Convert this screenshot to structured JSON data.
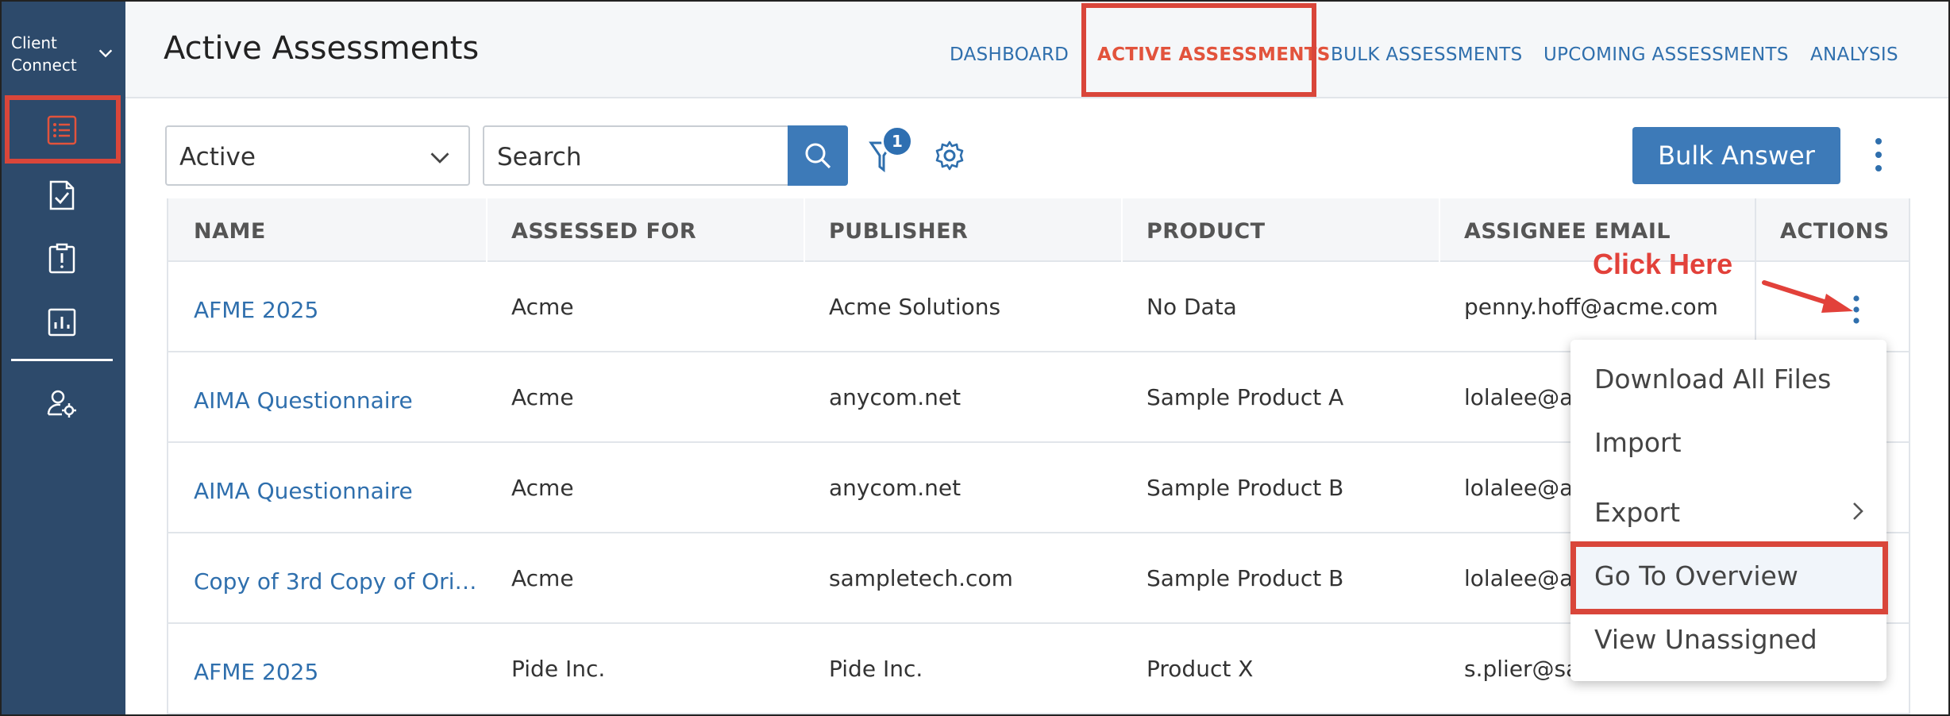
{
  "sidebar": {
    "client_label_line1": "Client",
    "client_label_line2": "Connect",
    "icons": [
      "list-icon",
      "checklist-icon",
      "alert-clipboard-icon",
      "report-chart-icon",
      "user-settings-icon"
    ]
  },
  "header": {
    "title": "Active Assessments",
    "nav": [
      "DASHBOARD",
      "ACTIVE ASSESSMENTS",
      "BULK ASSESSMENTS",
      "UPCOMING ASSESSMENTS",
      "ANALYSIS"
    ],
    "active_nav": "ACTIVE ASSESSMENTS"
  },
  "toolbar": {
    "status_select": "Active",
    "search_placeholder": "Search",
    "filter_count": "1",
    "bulk_answer_label": "Bulk Answer"
  },
  "table": {
    "columns": [
      "NAME",
      "ASSESSED FOR",
      "PUBLISHER",
      "PRODUCT",
      "ASSIGNEE EMAIL",
      "ACTIONS"
    ],
    "rows": [
      {
        "name": "AFME 2025",
        "assessed_for": "Acme",
        "publisher": "Acme Solutions",
        "product": "No Data",
        "email": "penny.hoff@acme.com"
      },
      {
        "name": "AIMA Questionnaire",
        "assessed_for": "Acme",
        "publisher": "anycom.net",
        "product": "Sample Product A",
        "email": "lolalee@ac"
      },
      {
        "name": "AIMA Questionnaire",
        "assessed_for": "Acme",
        "publisher": "anycom.net",
        "product": "Sample Product B",
        "email": "lolalee@ac"
      },
      {
        "name": "Copy of 3rd Copy of Ori…",
        "assessed_for": "Acme",
        "publisher": "sampletech.com",
        "product": "Sample Product B",
        "email": "lolalee@ac"
      },
      {
        "name": "AFME 2025",
        "assessed_for": "Pide Inc.",
        "publisher": "Pide Inc.",
        "product": "Product X",
        "email": "s.plier@sa"
      }
    ]
  },
  "annotation": {
    "text": "Click Here",
    "color": "#e2413a"
  },
  "menu": {
    "items": [
      "Download All Files",
      "Import",
      "Export",
      "Go To Overview",
      "View Unassigned"
    ],
    "highlighted": "Go To Overview"
  },
  "colors": {
    "sidebar": "#2d4a6b",
    "primary": "#3d7ab8",
    "link": "#2f6fad",
    "highlight": "#d9463a"
  }
}
